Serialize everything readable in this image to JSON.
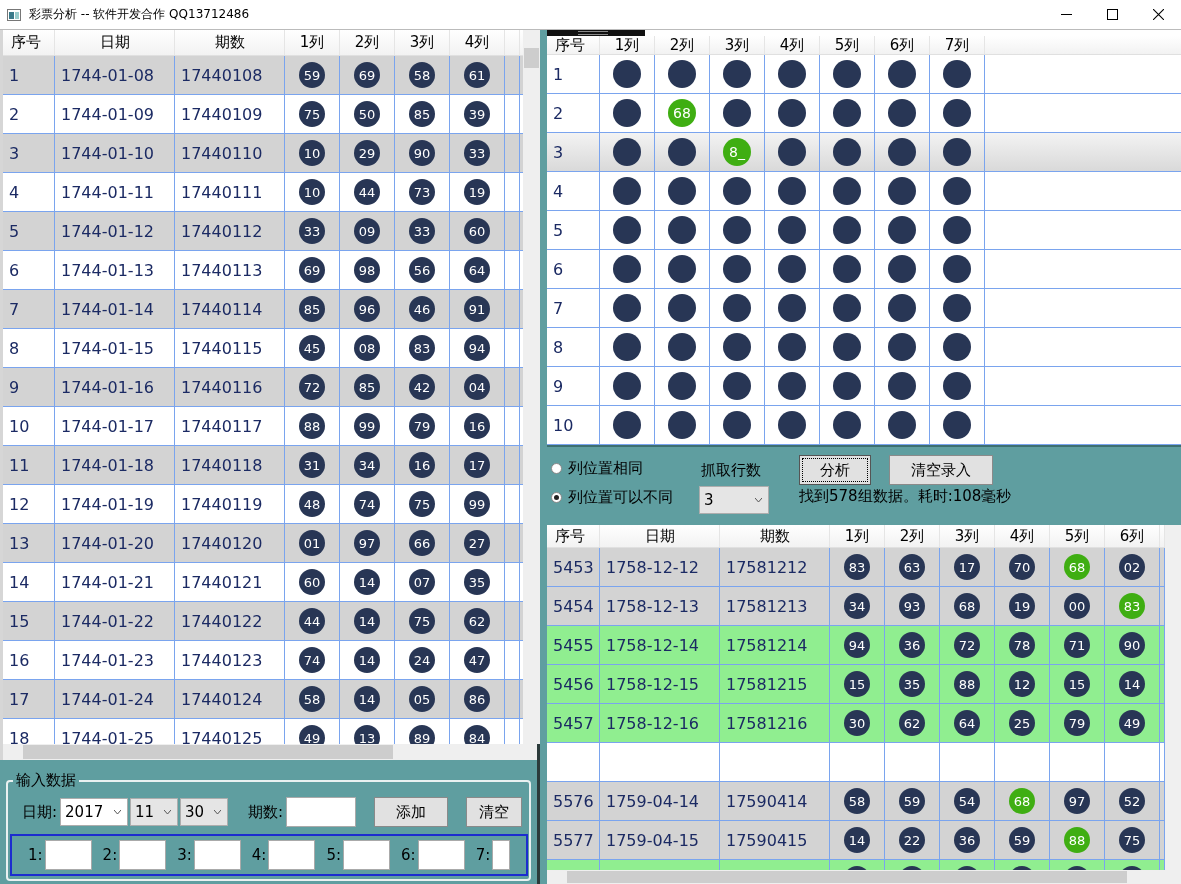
{
  "window": {
    "title": "彩票分析 -- 软件开发合作 QQ13712486"
  },
  "history_table": {
    "columns": [
      "序号",
      "日期",
      "期数",
      "1列",
      "2列",
      "3列",
      "4列"
    ],
    "rows": [
      {
        "no": "1",
        "date": "1744-01-08",
        "issue": "17440108",
        "balls": [
          "59",
          "69",
          "58",
          "61"
        ]
      },
      {
        "no": "2",
        "date": "1744-01-09",
        "issue": "17440109",
        "balls": [
          "75",
          "50",
          "85",
          "39"
        ]
      },
      {
        "no": "3",
        "date": "1744-01-10",
        "issue": "17440110",
        "balls": [
          "10",
          "29",
          "90",
          "33"
        ]
      },
      {
        "no": "4",
        "date": "1744-01-11",
        "issue": "17440111",
        "balls": [
          "10",
          "44",
          "73",
          "19"
        ]
      },
      {
        "no": "5",
        "date": "1744-01-12",
        "issue": "17440112",
        "balls": [
          "33",
          "09",
          "33",
          "60"
        ]
      },
      {
        "no": "6",
        "date": "1744-01-13",
        "issue": "17440113",
        "balls": [
          "69",
          "98",
          "56",
          "64"
        ]
      },
      {
        "no": "7",
        "date": "1744-01-14",
        "issue": "17440114",
        "balls": [
          "85",
          "96",
          "46",
          "91"
        ]
      },
      {
        "no": "8",
        "date": "1744-01-15",
        "issue": "17440115",
        "balls": [
          "45",
          "08",
          "83",
          "94"
        ]
      },
      {
        "no": "9",
        "date": "1744-01-16",
        "issue": "17440116",
        "balls": [
          "72",
          "85",
          "42",
          "04"
        ]
      },
      {
        "no": "10",
        "date": "1744-01-17",
        "issue": "17440117",
        "balls": [
          "88",
          "99",
          "79",
          "16"
        ]
      },
      {
        "no": "11",
        "date": "1744-01-18",
        "issue": "17440118",
        "balls": [
          "31",
          "34",
          "16",
          "17"
        ]
      },
      {
        "no": "12",
        "date": "1744-01-19",
        "issue": "17440119",
        "balls": [
          "48",
          "74",
          "75",
          "99"
        ]
      },
      {
        "no": "13",
        "date": "1744-01-20",
        "issue": "17440120",
        "balls": [
          "01",
          "97",
          "66",
          "27"
        ]
      },
      {
        "no": "14",
        "date": "1744-01-21",
        "issue": "17440121",
        "balls": [
          "60",
          "14",
          "07",
          "35"
        ]
      },
      {
        "no": "15",
        "date": "1744-01-22",
        "issue": "17440122",
        "balls": [
          "44",
          "14",
          "75",
          "62"
        ]
      },
      {
        "no": "16",
        "date": "1744-01-23",
        "issue": "17440123",
        "balls": [
          "74",
          "14",
          "24",
          "47"
        ]
      },
      {
        "no": "17",
        "date": "1744-01-24",
        "issue": "17440124",
        "balls": [
          "58",
          "14",
          "05",
          "86"
        ]
      },
      {
        "no": "18",
        "date": "1744-01-25",
        "issue": "17440125",
        "balls": [
          "49",
          "13",
          "89",
          "84"
        ]
      }
    ]
  },
  "input_group": {
    "title": "输入数据",
    "date_label": "日期:",
    "year": "2017",
    "month": "11",
    "day": "30",
    "issue_label": "期数:",
    "buttons": [
      "添加",
      "清空"
    ],
    "slots": [
      "1:",
      "2:",
      "3:",
      "4:",
      "5:",
      "6:",
      "7:"
    ]
  },
  "pattern_grid": {
    "row_header": "序号",
    "columns": [
      "1列",
      "2列",
      "3列",
      "4列",
      "5列",
      "6列",
      "7列"
    ],
    "rows": [
      {
        "no": "1",
        "selected": false,
        "cells": [
          {
            "hit": false
          },
          {
            "hit": false
          },
          {
            "hit": false
          },
          {
            "hit": false
          },
          {
            "hit": false
          },
          {
            "hit": false
          },
          {
            "hit": false
          }
        ]
      },
      {
        "no": "2",
        "selected": false,
        "cells": [
          {
            "hit": false
          },
          {
            "n": "68",
            "hit": true
          },
          {
            "hit": false
          },
          {
            "hit": false
          },
          {
            "hit": false
          },
          {
            "hit": false
          },
          {
            "hit": false
          }
        ]
      },
      {
        "no": "3",
        "selected": true,
        "cells": [
          {
            "hit": false
          },
          {
            "hit": false
          },
          {
            "n": "8_",
            "hit": true
          },
          {
            "hit": false
          },
          {
            "hit": false
          },
          {
            "hit": false
          },
          {
            "hit": false
          }
        ]
      },
      {
        "no": "4",
        "selected": false,
        "cells": [
          {
            "hit": false
          },
          {
            "hit": false
          },
          {
            "hit": false
          },
          {
            "hit": false
          },
          {
            "hit": false
          },
          {
            "hit": false
          },
          {
            "hit": false
          }
        ]
      },
      {
        "no": "5",
        "selected": false,
        "cells": [
          {
            "hit": false
          },
          {
            "hit": false
          },
          {
            "hit": false
          },
          {
            "hit": false
          },
          {
            "hit": false
          },
          {
            "hit": false
          },
          {
            "hit": false
          }
        ]
      },
      {
        "no": "6",
        "selected": false,
        "cells": [
          {
            "hit": false
          },
          {
            "hit": false
          },
          {
            "hit": false
          },
          {
            "hit": false
          },
          {
            "hit": false
          },
          {
            "hit": false
          },
          {
            "hit": false
          }
        ]
      },
      {
        "no": "7",
        "selected": false,
        "cells": [
          {
            "hit": false
          },
          {
            "hit": false
          },
          {
            "hit": false
          },
          {
            "hit": false
          },
          {
            "hit": false
          },
          {
            "hit": false
          },
          {
            "hit": false
          }
        ]
      },
      {
        "no": "8",
        "selected": false,
        "cells": [
          {
            "hit": false
          },
          {
            "hit": false
          },
          {
            "hit": false
          },
          {
            "hit": false
          },
          {
            "hit": false
          },
          {
            "hit": false
          },
          {
            "hit": false
          }
        ]
      },
      {
        "no": "9",
        "selected": false,
        "cells": [
          {
            "hit": false
          },
          {
            "hit": false
          },
          {
            "hit": false
          },
          {
            "hit": false
          },
          {
            "hit": false
          },
          {
            "hit": false
          },
          {
            "hit": false
          }
        ]
      },
      {
        "no": "10",
        "selected": false,
        "cells": [
          {
            "hit": false
          },
          {
            "hit": false
          },
          {
            "hit": false
          },
          {
            "hit": false
          },
          {
            "hit": false
          },
          {
            "hit": false
          },
          {
            "hit": false
          }
        ]
      }
    ]
  },
  "options": {
    "radios": [
      {
        "label": "列位置相同",
        "selected": false
      },
      {
        "label": "列位置可以不同",
        "selected": true
      }
    ],
    "rows_label": "抓取行数",
    "rows_value": "3",
    "buttons": [
      {
        "label": "分析",
        "focused": true
      },
      {
        "label": "清空录入",
        "focused": false
      }
    ],
    "status": "找到578组数据。耗时:108毫秒"
  },
  "result_table": {
    "columns": [
      "序号",
      "日期",
      "期数",
      "1列",
      "2列",
      "3列",
      "4列",
      "5列",
      "6列"
    ],
    "rows": [
      {
        "kind": "plain",
        "no": "5453",
        "date": "1758-12-12",
        "issue": "17581212",
        "balls": [
          {
            "n": "83",
            "hit": false
          },
          {
            "n": "63",
            "hit": false
          },
          {
            "n": "17",
            "hit": false
          },
          {
            "n": "70",
            "hit": false
          },
          {
            "n": "68",
            "hit": true
          },
          {
            "n": "02",
            "hit": false
          }
        ]
      },
      {
        "kind": "plain",
        "no": "5454",
        "date": "1758-12-13",
        "issue": "17581213",
        "balls": [
          {
            "n": "34",
            "hit": false
          },
          {
            "n": "93",
            "hit": false
          },
          {
            "n": "68",
            "hit": false
          },
          {
            "n": "19",
            "hit": false
          },
          {
            "n": "00",
            "hit": false
          },
          {
            "n": "83",
            "hit": true
          }
        ]
      },
      {
        "kind": "match",
        "no": "5455",
        "date": "1758-12-14",
        "issue": "17581214",
        "balls": [
          {
            "n": "94",
            "hit": false
          },
          {
            "n": "36",
            "hit": false
          },
          {
            "n": "72",
            "hit": false
          },
          {
            "n": "78",
            "hit": false
          },
          {
            "n": "71",
            "hit": false
          },
          {
            "n": "90",
            "hit": false
          }
        ]
      },
      {
        "kind": "match",
        "no": "5456",
        "date": "1758-12-15",
        "issue": "17581215",
        "balls": [
          {
            "n": "15",
            "hit": false
          },
          {
            "n": "35",
            "hit": false
          },
          {
            "n": "88",
            "hit": false
          },
          {
            "n": "12",
            "hit": false
          },
          {
            "n": "15",
            "hit": false
          },
          {
            "n": "14",
            "hit": false
          }
        ]
      },
      {
        "kind": "match",
        "no": "5457",
        "date": "1758-12-16",
        "issue": "17581216",
        "balls": [
          {
            "n": "30",
            "hit": false
          },
          {
            "n": "62",
            "hit": false
          },
          {
            "n": "64",
            "hit": false
          },
          {
            "n": "25",
            "hit": false
          },
          {
            "n": "79",
            "hit": false
          },
          {
            "n": "49",
            "hit": false
          }
        ]
      },
      {
        "kind": "gap"
      },
      {
        "kind": "plain",
        "no": "5576",
        "date": "1759-04-14",
        "issue": "17590414",
        "balls": [
          {
            "n": "58",
            "hit": false
          },
          {
            "n": "59",
            "hit": false
          },
          {
            "n": "54",
            "hit": false
          },
          {
            "n": "68",
            "hit": true
          },
          {
            "n": "97",
            "hit": false
          },
          {
            "n": "52",
            "hit": false
          }
        ]
      },
      {
        "kind": "plain",
        "no": "5577",
        "date": "1759-04-15",
        "issue": "17590415",
        "balls": [
          {
            "n": "14",
            "hit": false
          },
          {
            "n": "22",
            "hit": false
          },
          {
            "n": "36",
            "hit": false
          },
          {
            "n": "59",
            "hit": false
          },
          {
            "n": "88",
            "hit": true
          },
          {
            "n": "75",
            "hit": false
          }
        ]
      },
      {
        "kind": "match",
        "balls": [
          {
            "hit": false
          },
          {
            "hit": false
          },
          {
            "hit": false
          },
          {
            "hit": false
          },
          {
            "hit": false
          },
          {
            "hit": false
          }
        ]
      }
    ]
  }
}
